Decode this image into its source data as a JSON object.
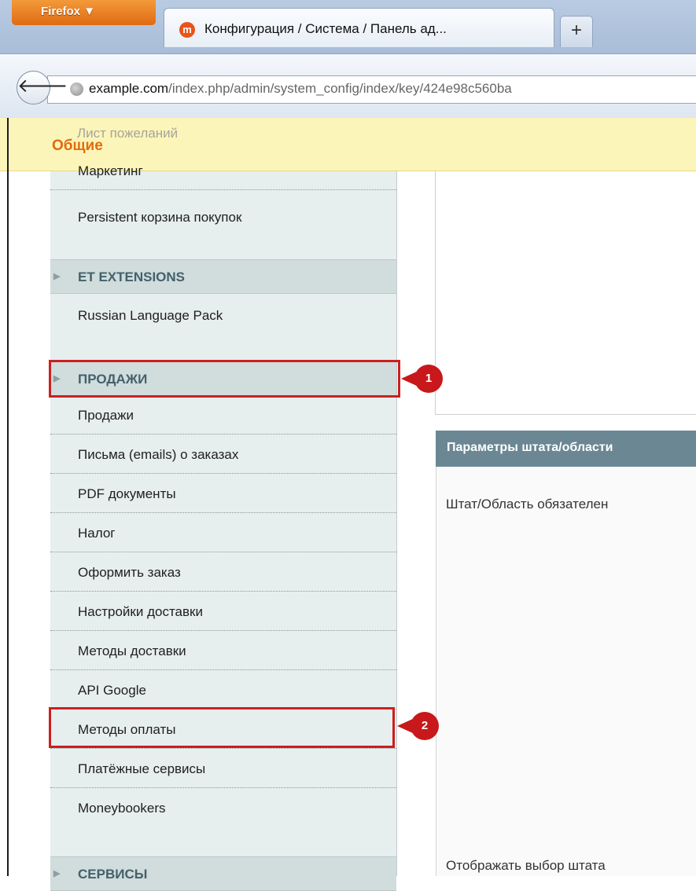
{
  "browser": {
    "menu_button": "Firefox",
    "tab_title": "Конфигурация / Система / Панель ад...",
    "favicon_letter": "m",
    "new_tab_symbol": "+",
    "url_domain": "example.com",
    "url_path": "/index.php/admin/system_config/index/key/424e98c560ba"
  },
  "header": {
    "title": "Общие",
    "ghost_item": "Лист пожеланий"
  },
  "sidebar": {
    "items_top": [
      {
        "label": "Маркетинг"
      },
      {
        "label": "Persistent корзина покупок"
      }
    ],
    "section_et": {
      "label": "ET EXTENSIONS"
    },
    "et_items": [
      {
        "label": "Russian Language Pack"
      }
    ],
    "section_sales": {
      "label": "ПРОДАЖИ"
    },
    "sales_items": [
      {
        "label": "Продажи"
      },
      {
        "label": "Письма (emails) о заказах"
      },
      {
        "label": "PDF документы"
      },
      {
        "label": "Налог"
      },
      {
        "label": "Оформить заказ"
      },
      {
        "label": "Настройки доставки"
      },
      {
        "label": "Методы доставки"
      },
      {
        "label": "API Google"
      },
      {
        "label": "Методы оплаты"
      },
      {
        "label": "Платёжные сервисы"
      },
      {
        "label": "Moneybookers"
      }
    ],
    "section_services": {
      "label": "СЕРВИСЫ"
    }
  },
  "callouts": [
    {
      "number": "1"
    },
    {
      "number": "2"
    }
  ],
  "main": {
    "fieldset_title": "Параметры штата/области",
    "field_required_label": "Штат/Область обязателен",
    "field_display_label": "Отображать выбор штата"
  },
  "colors": {
    "highlight": "#cc1f1f",
    "header_title": "#e26b0b",
    "fieldset_header": "#6b8793"
  }
}
